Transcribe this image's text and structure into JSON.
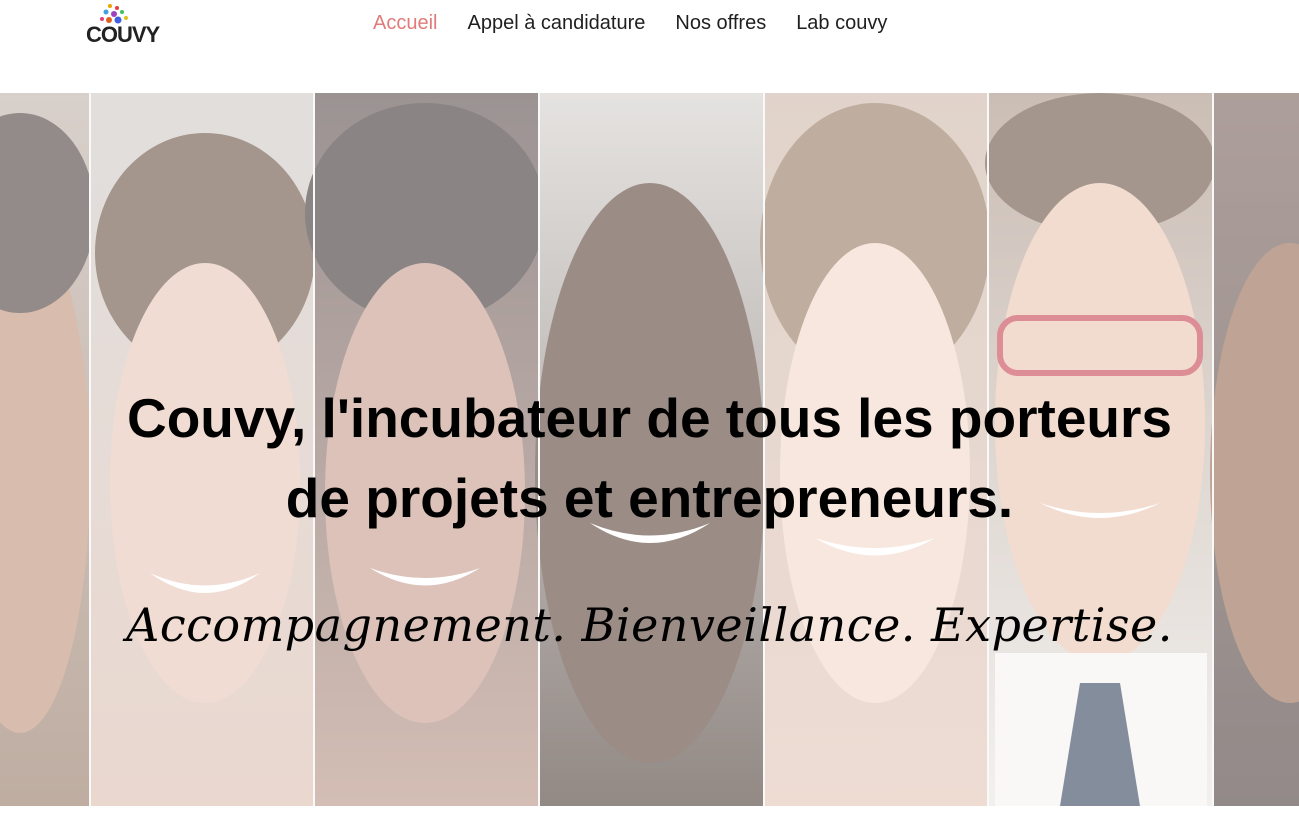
{
  "header": {
    "logo_text": "COUVY",
    "nav": [
      {
        "label": "Accueil",
        "active": true
      },
      {
        "label": "Appel à candidature",
        "active": false
      },
      {
        "label": "Nos offres",
        "active": false
      },
      {
        "label": "Lab couvy",
        "active": false
      }
    ]
  },
  "hero": {
    "headline_line1": "Couvy, l'incubateur de tous les porteurs",
    "headline_line2": "de projets et entrepreneurs.",
    "tagline": "Accompagnement. Bienveillance. Expertise."
  },
  "colors": {
    "nav_active": "#e07b7b",
    "nav_default": "#1f1f1f",
    "text": "#000000"
  }
}
